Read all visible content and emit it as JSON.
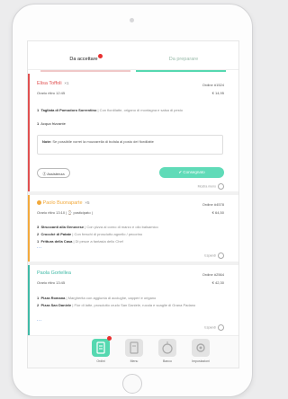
{
  "tabs": {
    "to_accept": "Da accettare",
    "to_prepare": "Da preparare"
  },
  "order1": {
    "customer": "Elisa Toffoli",
    "people": " ×1",
    "order_no": "Ordine #1524",
    "time": "Orario ritiro 12:45",
    "total": "€ 14,95",
    "items": [
      {
        "qty": "1",
        "name": "Tagliata di Pomodoro Sorrentino",
        "desc": "| Con fiordilatte, origano di montagna e salsa di pesto"
      },
      {
        "qty": "1",
        "name": "Acqua frizzante",
        "desc": ""
      }
    ],
    "note_label": "Note:",
    "note_text": "Se possibile vorrei la mozzarella di bufala al posto del fiordilatte",
    "assist_label": "Ⓩ Assistenza",
    "deliver_label": "✔ Consegnato",
    "more": "Mostra meno"
  },
  "order2": {
    "customer": "Paolo Buonaparte",
    "people": " ×5",
    "order_no": "Ordine #4578",
    "time": "Orario ritiro 13:10 | ⌚ posticipato |",
    "total": "€ 64,50",
    "items": [
      {
        "qty": "3",
        "name": "Struccanti alla Genovese",
        "desc": "| Con pizza al corno di marzo e olio balsamico"
      },
      {
        "qty": "2",
        "name": "Crocchè di Patate",
        "desc": "| Con freschi di prosciutto agnello / pecorino"
      },
      {
        "qty": "1",
        "name": "Frittura della Casa",
        "desc": "| Di pesce a fantasia dello Chef"
      }
    ],
    "ellipsis": "...",
    "more": "Espandi"
  },
  "order3": {
    "customer": "Paola Gortellea",
    "order_no": "Ordine #2564",
    "time": "Orario ritiro 13:45",
    "total": "€ 42,30",
    "items": [
      {
        "qty": "1",
        "name": "Pizza Romana",
        "desc": "| Margherita con aggiunta di acciughe, capperi e origano"
      },
      {
        "qty": "2",
        "name": "Pizza San Daniele",
        "desc": "| Fior di latte, prosciutto crudo San Daniele, rucola e scaglie di Grana Padano"
      }
    ],
    "ellipsis": "...",
    "more": "Espandi"
  },
  "bottom_nav": [
    {
      "label": "Ordini",
      "icon": "orders-icon"
    },
    {
      "label": "Menu",
      "icon": "menu-icon"
    },
    {
      "label": "Banco",
      "icon": "counter-icon"
    },
    {
      "label": "Impostazioni",
      "icon": "settings-icon"
    }
  ],
  "colors": {
    "accent_green": "#55d8b0",
    "accent_red": "#e05050",
    "accent_orange": "#f2a93b",
    "accent_teal": "#3fb9a6"
  }
}
